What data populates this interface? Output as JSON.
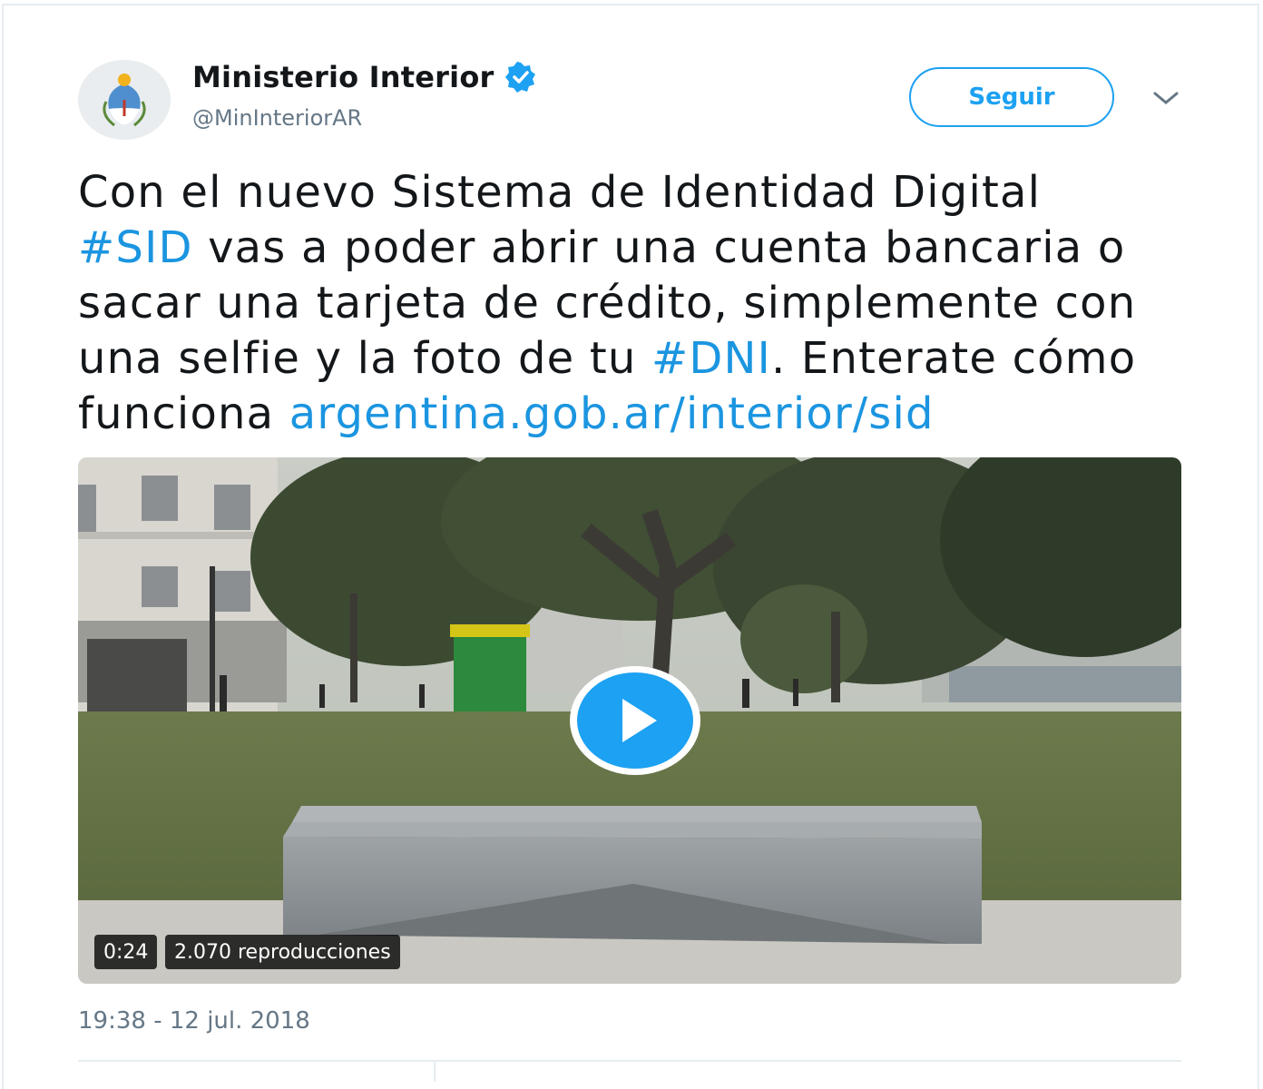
{
  "author": {
    "name": "Ministerio Interior",
    "handle": "@MinInteriorAR",
    "avatar_icon": "argentina-coat-of-arms-icon",
    "verified_icon": "verified-badge-icon"
  },
  "actions": {
    "follow_label": "Seguir",
    "menu_icon": "chevron-down-icon"
  },
  "tweet": {
    "line1": "Con el nuevo Sistema de Identidad Digital",
    "hashtag1": "#SID",
    "line2": " vas a poder abrir una cuenta bancaria o",
    "line3": "sacar una tarjeta de crédito, simplemente con",
    "line4_pre": "una selfie y la foto de tu ",
    "hashtag2": "#DNI",
    "line4_post": ". Enterate cómo",
    "line5_pre": "funciona ",
    "url": "argentina.gob.ar/interior/sid"
  },
  "video": {
    "duration": "0:24",
    "views": "2.070 reproducciones",
    "play_icon": "play-icon"
  },
  "timestamp": "19:38 - 12 jul. 2018",
  "colors": {
    "accent": "#1da1f2",
    "link": "#1b95e0",
    "text": "#14171a",
    "muted": "#657786"
  }
}
